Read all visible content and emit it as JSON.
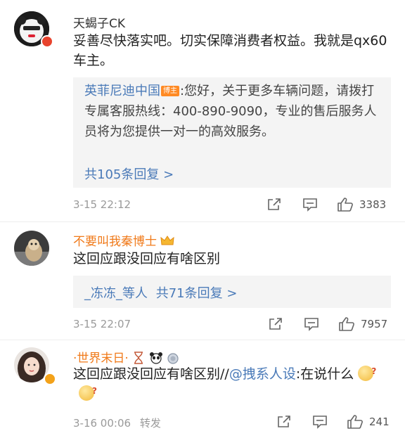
{
  "comments": [
    {
      "author": "天蝎子CK",
      "text": "妥善尽快落实吧。切实保障消费者权益。我就是qx60车主。",
      "reply": {
        "author": "英菲尼迪中国",
        "badge": "博主",
        "text": ":您好，关于更多车辆问题，请拨打专属客服热线：400-890-9090，专业的售后服务人员将为您提供一对一的高效服务。",
        "more_link": "共105条回复 >"
      },
      "time": "3-15 22:12",
      "likes": "3383"
    },
    {
      "author": "不要叫我秦博士",
      "author_color": "#f07a1a",
      "text": "这回应跟没回应有啥区别",
      "reply_summary": {
        "names": "_冻冻_",
        "suffix": "等人",
        "link": "共71条回复 >"
      },
      "time": "3-15 22:07",
      "likes": "7957"
    },
    {
      "author": "·世界末日·",
      "author_color": "#f07a1a",
      "text_before": "这回应跟没回应有啥区别//",
      "mention": "@拽系人设",
      "text_after": ":在说什么",
      "time": "3-16 00:06",
      "repost": "转发",
      "likes": "241"
    }
  ],
  "icons": {
    "share": "share-icon",
    "comment": "comment-icon",
    "like": "thumbs-up-icon"
  },
  "colors": {
    "link": "#4a7ab8",
    "vip_name": "#f07a1a",
    "reply_bg": "#f4f4f4",
    "badge": "#ff8a24"
  }
}
